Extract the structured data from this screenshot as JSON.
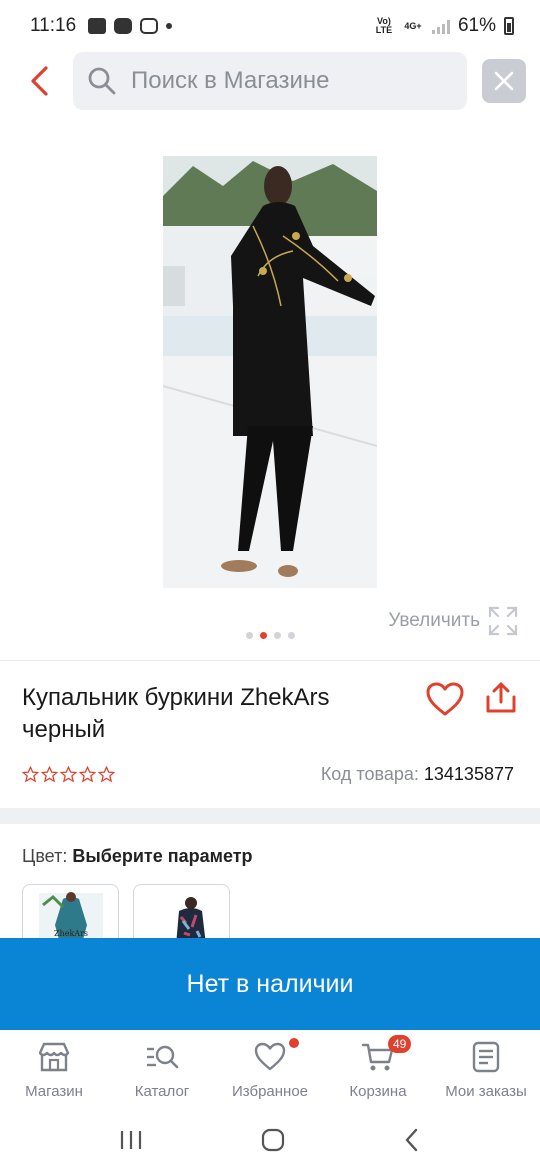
{
  "status_bar": {
    "time": "11:16",
    "battery": "61%",
    "network": "4G+",
    "volte": "Vo) LTE"
  },
  "search": {
    "placeholder": "Поиск в Магазине"
  },
  "gallery": {
    "zoom_label": "Увеличить",
    "pages": 4,
    "active_page": 2
  },
  "product": {
    "title": "Купальник буркини ZhekArs черный",
    "rating": 0,
    "code_label": "Код товара:",
    "code_value": "134135877"
  },
  "variants": {
    "color_label": "Цвет:",
    "color_value": "Выберите параметр",
    "swatch_1_brand": "ZhekArs"
  },
  "buy_button": {
    "label": "Нет в наличии"
  },
  "bottom_nav": {
    "items": [
      {
        "label": "Магазин"
      },
      {
        "label": "Каталог"
      },
      {
        "label": "Избранное"
      },
      {
        "label": "Корзина"
      },
      {
        "label": "Мои заказы"
      }
    ],
    "cart_badge": "49"
  },
  "colors": {
    "accent_red": "#e0402e",
    "primary_blue": "#0a84d4"
  }
}
